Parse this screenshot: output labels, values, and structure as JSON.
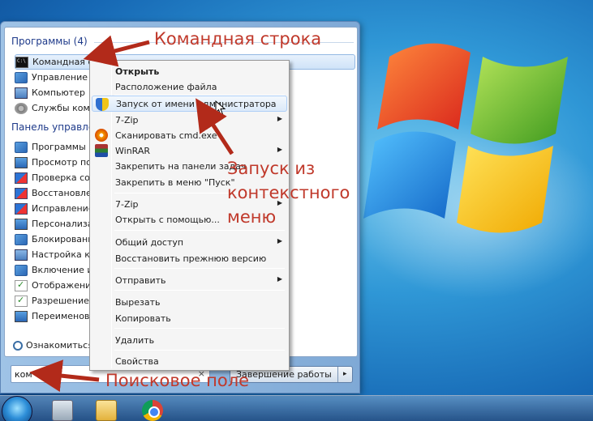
{
  "start_menu": {
    "programs_header": "Программы (4)",
    "programs": [
      {
        "label": "Командная строка",
        "icon": "cmd-icon"
      },
      {
        "label": "Управление к",
        "icon": "control-icon"
      },
      {
        "label": "Компьютер",
        "icon": "computer-icon"
      },
      {
        "label": "Службы комг",
        "icon": "services-icon"
      }
    ],
    "control_panel_header": "Панель управле",
    "control_panel": [
      {
        "label": "Программы и",
        "icon": "programs-icon"
      },
      {
        "label": "Просмотр пос",
        "icon": "view-icon"
      },
      {
        "label": "Проверка сос",
        "icon": "flag-icon"
      },
      {
        "label": "Восстановлен",
        "icon": "flag-icon"
      },
      {
        "label": "Исправление",
        "icon": "flag-icon"
      },
      {
        "label": "Персонализац",
        "icon": "personalize-icon"
      },
      {
        "label": "Блокировани",
        "icon": "lock-icon"
      },
      {
        "label": "Настройка ко",
        "icon": "settings-icon"
      },
      {
        "label": "Включение ил",
        "icon": "features-icon"
      },
      {
        "label": "Отображение",
        "icon": "display-icon"
      },
      {
        "label": "Разрешение у",
        "icon": "check-icon"
      },
      {
        "label": "Переименова",
        "icon": "rename-icon"
      }
    ],
    "more_results": "Ознакомиться с",
    "search_value": "ком",
    "search_clear": "×",
    "shutdown_label": "Завершение работы",
    "shutdown_arrow": "▸"
  },
  "context_menu": {
    "items": [
      {
        "label": "Открыть",
        "bold": true
      },
      {
        "label": "Расположение файла"
      },
      {
        "label": "Запуск от имени администратора",
        "hover": true,
        "icon": "shield-icon"
      },
      {
        "label": "7-Zip",
        "submenu": true
      },
      {
        "label": "Сканировать cmd.exe",
        "icon": "scan-icon"
      },
      {
        "label": "WinRAR",
        "submenu": true,
        "icon": "winrar-icon"
      },
      {
        "label": "Закрепить на панели задач"
      },
      {
        "label": "Закрепить в меню \"Пуск\""
      },
      {
        "label": "7-Zip",
        "submenu": true
      },
      {
        "label": "Открыть с помощью..."
      },
      {
        "label": "Общий доступ",
        "submenu": true
      },
      {
        "label": "Восстановить прежнюю версию"
      },
      {
        "label": "Отправить",
        "submenu": true
      },
      {
        "label": "Вырезать"
      },
      {
        "label": "Копировать"
      },
      {
        "label": "Удалить"
      },
      {
        "label": "Свойства"
      }
    ],
    "submenu_arrow": "▶"
  },
  "annotations": {
    "cmd": "Командная строка",
    "runas_line1": "Запуск из",
    "runas_line2": "контекстного",
    "runas_line3": "меню",
    "search": "Поисковое поле"
  },
  "colors": {
    "annotation": "#c0392b",
    "header": "#1e3a8a"
  }
}
